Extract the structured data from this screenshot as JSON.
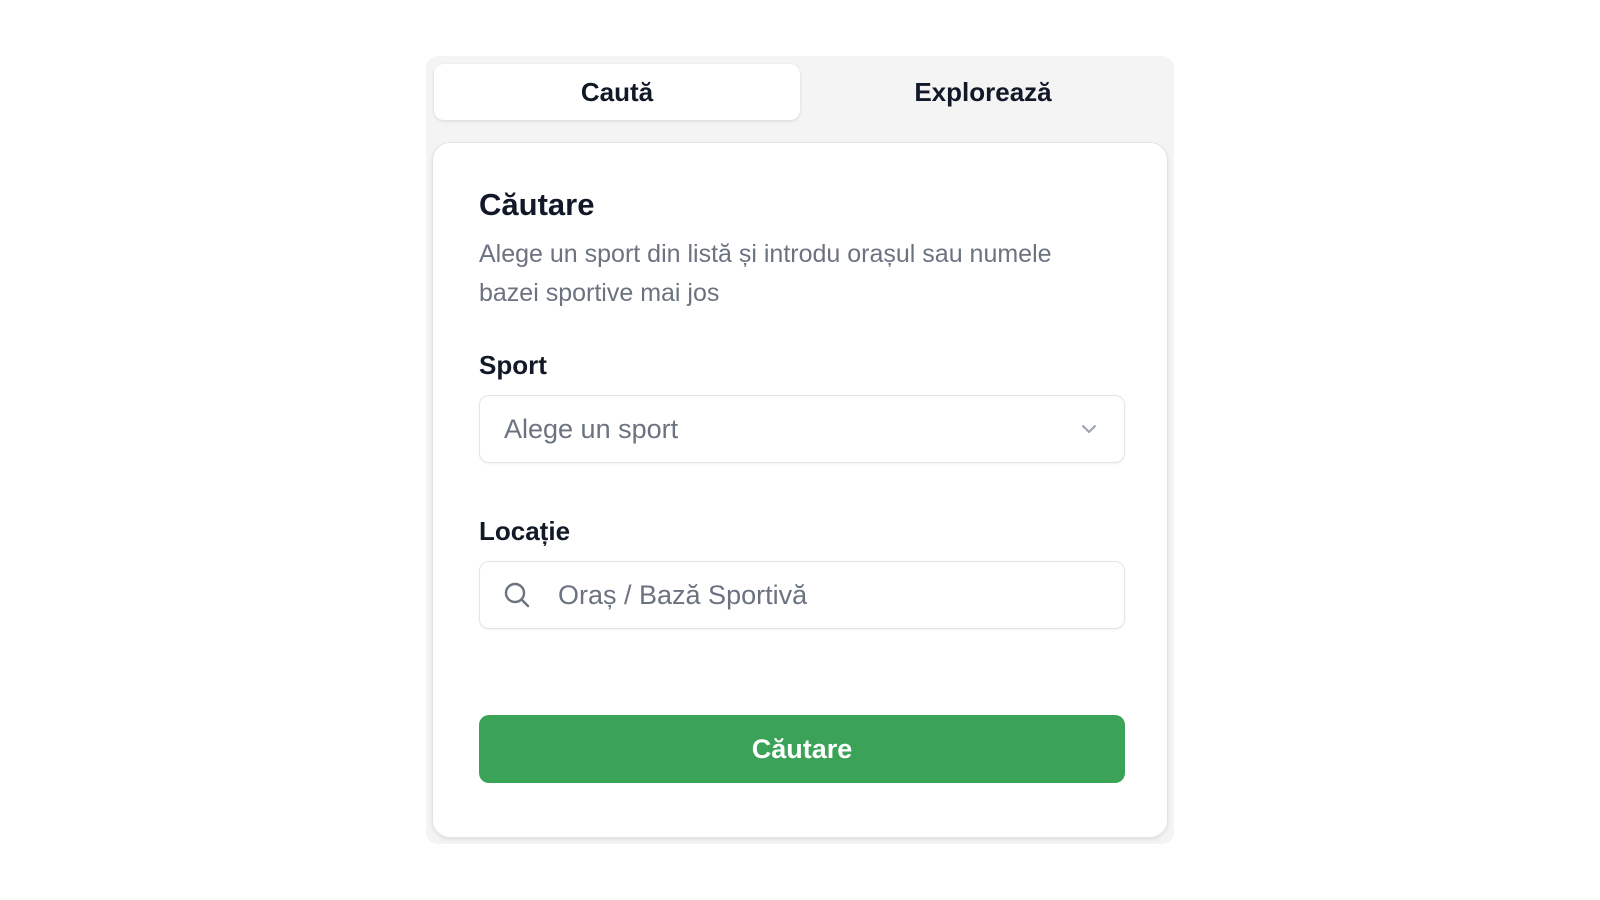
{
  "tabs": [
    {
      "label": "Caută",
      "active": true
    },
    {
      "label": "Explorează",
      "active": false
    }
  ],
  "card": {
    "title": "Căutare",
    "description": "Alege un sport din listă și introdu orașul sau numele bazei sportive mai jos"
  },
  "sport": {
    "label": "Sport",
    "placeholder": "Alege un sport",
    "icon": "chevron-down-icon"
  },
  "location": {
    "label": "Locație",
    "placeholder": "Oraș / Bază Sportivă",
    "value": "",
    "icon": "search-icon"
  },
  "submit": {
    "label": "Căutare",
    "color": "#3aa357"
  }
}
